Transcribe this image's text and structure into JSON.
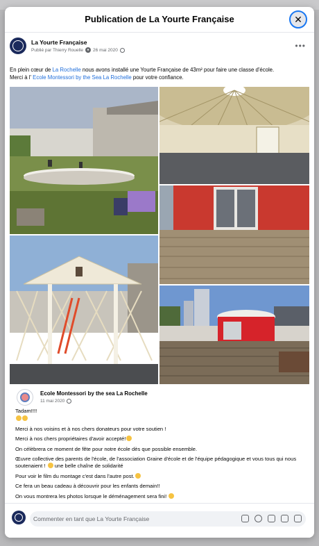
{
  "dialog": {
    "title": "Publication de La Yourte Française",
    "close_icon": "close-icon"
  },
  "post": {
    "author": "La Yourte Française",
    "posted_by": "Publié par Thierry Rouelle",
    "date": "26 mai 2020",
    "more_icon": "more-options-icon",
    "text_line1_a": "En plein cœur de ",
    "text_line1_link": "La Rochelle",
    "text_line1_b": " nous avons installé une Yourte Française de 43m² pour faire une classe d'école.",
    "text_line2_a": "Merci à l' ",
    "text_line2_link": "Ecole Montessori by the Sea La Rochelle",
    "text_line2_b": " pour votre confiance.",
    "photos": [
      {
        "name": "photo-platform-construction"
      },
      {
        "name": "photo-yurt-interior"
      },
      {
        "name": "photo-red-yurt-door-deck"
      },
      {
        "name": "photo-yurt-frame-scaffolding"
      },
      {
        "name": "photo-red-yurt-exterior"
      }
    ]
  },
  "comment": {
    "author": "Ecole Montessori by the sea La Rochelle",
    "date": "11 mai 2020",
    "lines": [
      "Tadam!!!!",
      "Merci à nos voisins et à nos chers donateurs pour votre soutien !",
      "Merci à nos chers propriétaires d'avoir accepté!",
      "On célèbrera ce moment de fête pour notre école dès que possible ensemble.",
      "Œuvre collective des parents de l'école, de l'association Graine d'école et de l'équipe pédagogique et vous tous qui nous soutenaient !",
      "une belle chaîne de solidarité",
      "Pour voir le film du montage c'est dans l'autre post.",
      "Ce fera un beau cadeau à découvrir pour les enfants demain!!",
      "On vous montrera les photos lorsque le déménagement sera fini!"
    ]
  },
  "composer": {
    "placeholder": "Commenter en tant que La Yourte Française",
    "icons": [
      "avatar-sticker-icon",
      "emoji-icon",
      "camera-icon",
      "gif-icon",
      "sticker-icon"
    ]
  }
}
